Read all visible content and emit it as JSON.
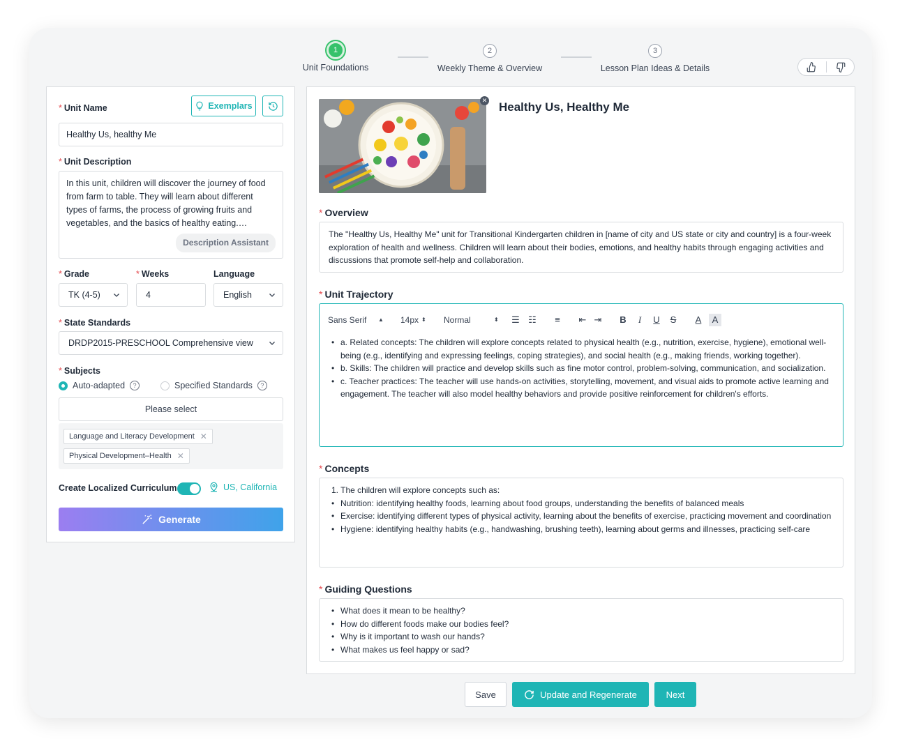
{
  "stepper": {
    "steps": [
      {
        "number": "1",
        "label": "Unit Foundations",
        "active": true
      },
      {
        "number": "2",
        "label": "Weekly Theme & Overview",
        "active": false
      },
      {
        "number": "3",
        "label": "Lesson Plan Ideas & Details",
        "active": false
      }
    ]
  },
  "form": {
    "unit_name_label": "Unit Name",
    "exemplars_label": "Exemplars",
    "unit_name_value": "Healthy Us, healthy Me",
    "unit_description_label": "Unit Description",
    "unit_description_value": "In this unit, children will discover the journey of food from farm to table. They will learn about different types of farms, the process of growing fruits and vegetables, and the basics of healthy eating. Interactive activities and hands-on experiences will help children explore where their food comes from.",
    "description_assistant_label": "Description Assistant",
    "grade_label": "Grade",
    "grade_value": "TK (4-5)",
    "weeks_label": "Weeks",
    "weeks_value": "4",
    "language_label": "Language",
    "language_value": "English",
    "state_standards_label": "State Standards",
    "state_standards_value": "DRDP2015-PRESCHOOL Comprehensive view",
    "subjects_label": "Subjects",
    "radio_auto_label": "Auto-adapted",
    "radio_specified_label": "Specified Standards",
    "subjects_placeholder": "Please select",
    "tags": [
      "Language and Literacy Development",
      "Physical Development–Health"
    ],
    "localized_label": "Create Localized Curriculum",
    "localized_on": true,
    "location": "US, California",
    "generate_label": "Generate"
  },
  "unit": {
    "title": "Healthy Us, Healthy Me",
    "overview_label": "Overview",
    "overview_text": "The \"Healthy Us, Healthy Me\" unit for Transitional Kindergarten children in [name of city and US state or city and country] is a four-week exploration of health and wellness. Children will learn about their bodies, emotions, and healthy habits through engaging activities and discussions that promote self-help and collaboration.",
    "trajectory_label": "Unit Trajectory",
    "toolbar": {
      "font": "Sans Serif",
      "size": "14px",
      "style": "Normal"
    },
    "trajectory_items": [
      "a. Related concepts: The children will explore concepts related to physical health (e.g., nutrition, exercise, hygiene), emotional well-being (e.g., identifying and expressing feelings, coping strategies), and social health (e.g., making friends, working together).",
      "b. Skills: The children will practice and develop skills such as fine motor control, problem-solving, communication, and socialization.",
      "c. Teacher practices: The teacher will use hands-on activities, storytelling, movement, and visual aids to promote active learning and engagement. The teacher will also model healthy behaviors and provide positive reinforcement for children's efforts."
    ],
    "concepts_label": "Concepts",
    "concepts_intro": "1. The children will explore concepts such as:",
    "concepts_items": [
      "Nutrition: identifying healthy foods, learning about food groups, understanding the benefits of balanced meals",
      "Exercise: identifying different types of physical activity, learning about the benefits of exercise, practicing movement and coordination",
      "Hygiene: identifying healthy habits (e.g., handwashing, brushing teeth), learning about germs and illnesses, practicing self-care"
    ],
    "guiding_label": "Guiding Questions",
    "guiding_items": [
      "What does it mean to be healthy?",
      "How do different foods make our bodies feel?",
      "Why is it important to wash our hands?",
      "What makes us feel happy or sad?"
    ]
  },
  "actions": {
    "save": "Save",
    "update": "Update and Regenerate",
    "next": "Next"
  },
  "colors": {
    "accent": "#1fb5b5",
    "step_active": "#36c26b",
    "required": "#e4484d"
  }
}
